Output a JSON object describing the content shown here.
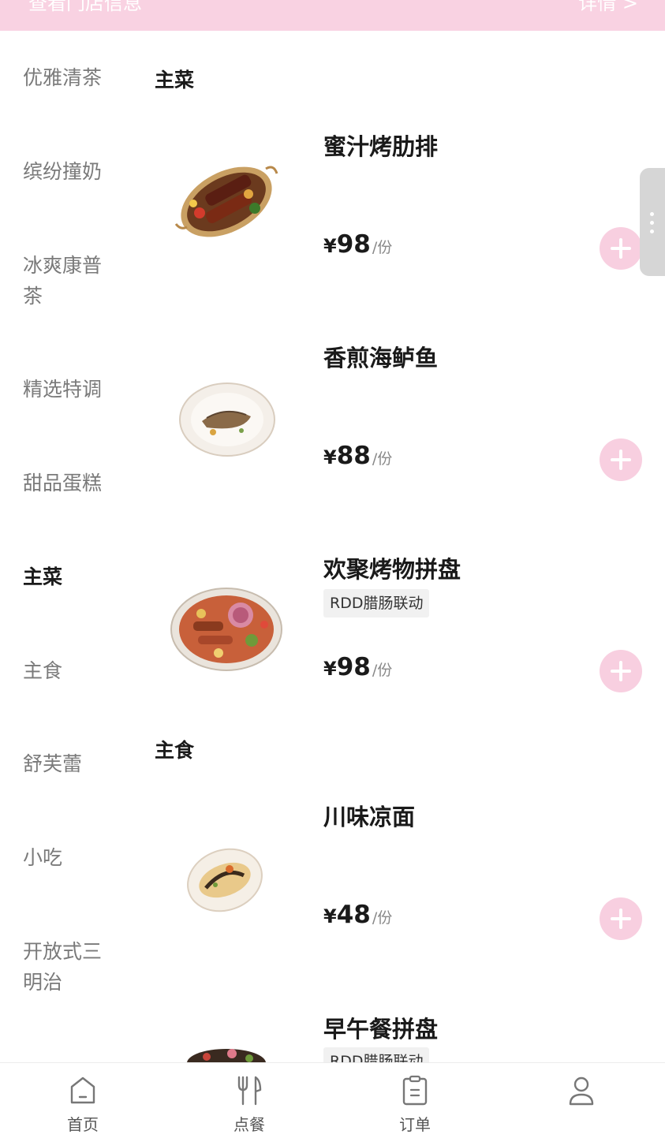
{
  "banner": {
    "left_text": "查看门店信息",
    "right_text": "详情 >"
  },
  "sidebar": {
    "categories": [
      {
        "label": "优雅清茶"
      },
      {
        "label": "缤纷撞奶"
      },
      {
        "label": "冰爽康普茶"
      },
      {
        "label": "精选特调"
      },
      {
        "label": "甜品蛋糕"
      },
      {
        "label": "主菜"
      },
      {
        "label": "主食"
      },
      {
        "label": "舒芙蕾"
      },
      {
        "label": "小吃"
      },
      {
        "label": "开放式三明治"
      }
    ],
    "active": "主菜"
  },
  "sections": [
    {
      "title": "主菜",
      "dishes": [
        {
          "name": "蜜汁烤肋排",
          "tag": "",
          "currency": "¥",
          "price": "98",
          "unit": "/份"
        },
        {
          "name": "香煎海鲈鱼",
          "tag": "",
          "currency": "¥",
          "price": "88",
          "unit": "/份"
        },
        {
          "name": "欢聚烤物拼盘",
          "tag": "RDD腊肠联动",
          "currency": "¥",
          "price": "98",
          "unit": "/份"
        }
      ]
    },
    {
      "title": "主食",
      "dishes": [
        {
          "name": "川味凉面",
          "tag": "",
          "currency": "¥",
          "price": "48",
          "unit": "/份"
        },
        {
          "name": "早午餐拼盘",
          "tag": "RDD腊肠联动",
          "currency": "¥",
          "price": "",
          "unit": ""
        }
      ]
    }
  ],
  "tabbar": {
    "items": [
      {
        "label": "首页",
        "icon": "home-icon"
      },
      {
        "label": "点餐",
        "icon": "fork-knife-icon"
      },
      {
        "label": "订单",
        "icon": "order-list-icon"
      },
      {
        "label": "",
        "icon": "user-icon"
      }
    ]
  },
  "colors": {
    "accent_pink": "#f8cfe0",
    "banner_pink": "#f9d2e2"
  }
}
